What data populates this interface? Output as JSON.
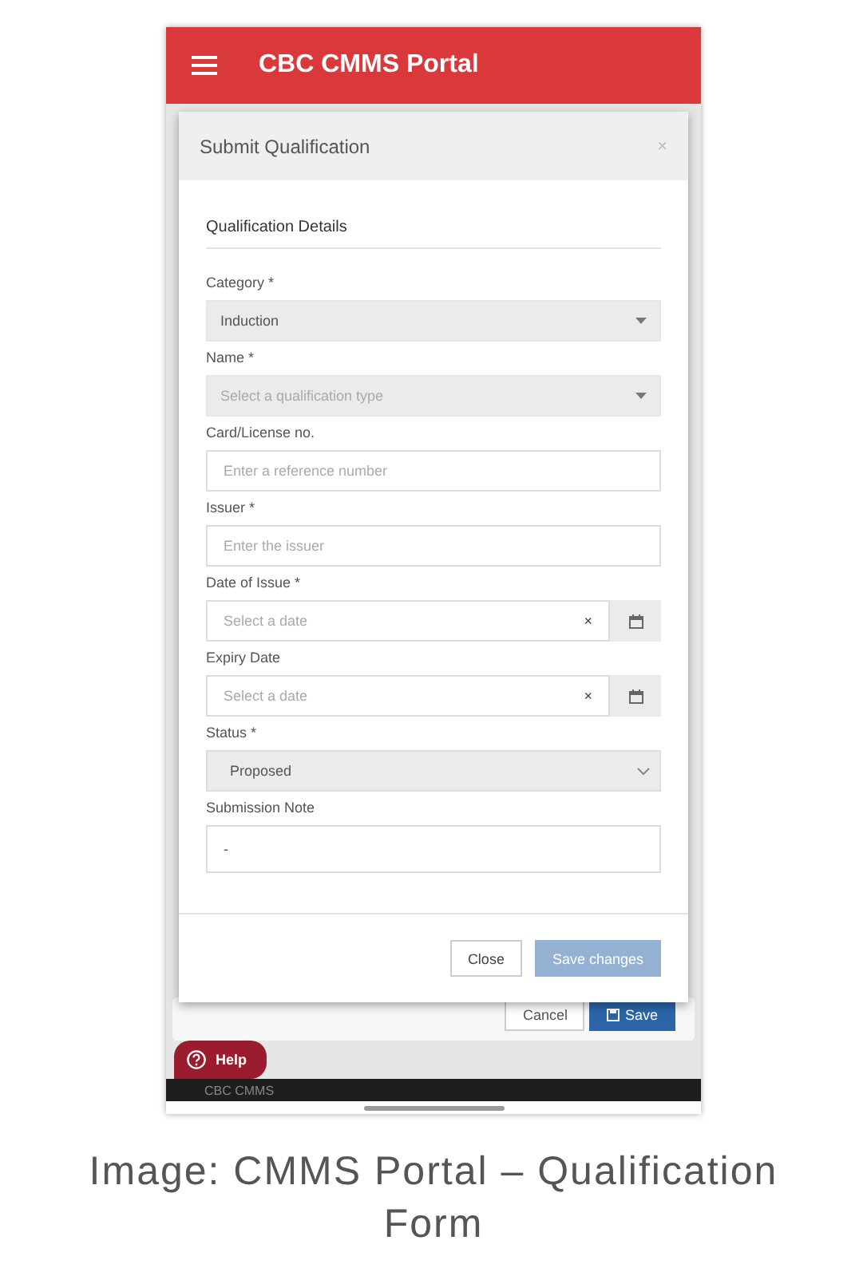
{
  "app_bar": {
    "title": "CBC CMMS Portal"
  },
  "dialog": {
    "title": "Submit Qualification",
    "close": "×",
    "section_title": "Qualification Details",
    "fields": [
      {
        "kind": "select",
        "label": "Category *",
        "value": "Induction"
      },
      {
        "kind": "select",
        "label": "Name *",
        "placeholder": "Select a qualification type"
      },
      {
        "kind": "text",
        "label": "Card/License no.",
        "placeholder": "Enter a reference number"
      },
      {
        "kind": "text",
        "label": "Issuer *",
        "placeholder": "Enter the issuer"
      },
      {
        "kind": "date",
        "label": "Date of Issue *",
        "placeholder": "Select a date",
        "clear": "×"
      },
      {
        "kind": "date",
        "label": "Expiry Date",
        "placeholder": "Select a date",
        "clear": "×"
      },
      {
        "kind": "dropdown",
        "label": "Status *",
        "value": "Proposed"
      },
      {
        "kind": "textarea",
        "label": "Submission Note",
        "value": "-"
      }
    ],
    "buttons": [
      {
        "label": "Close",
        "primary": false,
        "disabled": false
      },
      {
        "label": "Save changes",
        "primary": true,
        "disabled": true
      }
    ]
  },
  "page_buttons": [
    {
      "label": "Cancel",
      "primary": false
    },
    {
      "label": "Save",
      "primary": true
    }
  ],
  "help_button": {
    "label": "Help"
  },
  "footer": {
    "text": "CBC CMMS"
  },
  "caption": "Image: CMMS Portal – Qualification Form"
}
